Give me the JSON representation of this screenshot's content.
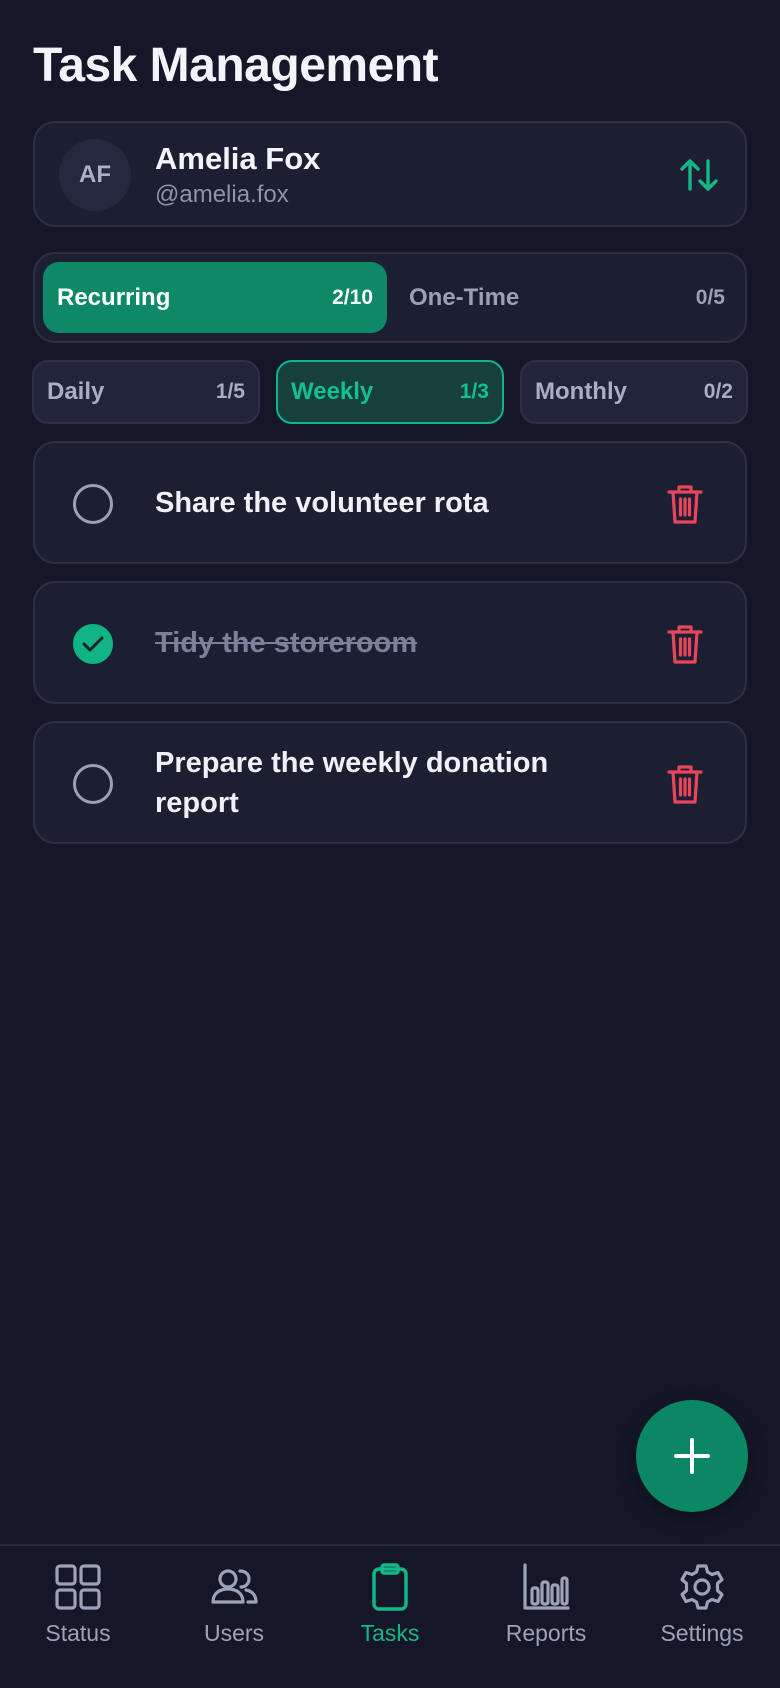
{
  "header": {
    "title": "Task Management"
  },
  "user": {
    "initials": "AF",
    "name": "Amelia Fox",
    "handle": "@amelia.fox"
  },
  "mode_tabs": [
    {
      "label": "Recurring",
      "count": "2/10",
      "active": true
    },
    {
      "label": "One-Time",
      "count": "0/5",
      "active": false
    }
  ],
  "period_tabs": [
    {
      "label": "Daily",
      "count": "1/5",
      "active": false
    },
    {
      "label": "Weekly",
      "count": "1/3",
      "active": true
    },
    {
      "label": "Monthly",
      "count": "0/2",
      "active": false
    }
  ],
  "tasks": [
    {
      "text": "Share the volunteer rota",
      "done": false
    },
    {
      "text": "Tidy the storeroom",
      "done": true
    },
    {
      "text": "Prepare the weekly donation report",
      "done": false
    }
  ],
  "nav": [
    {
      "label": "Status",
      "icon": "grid-icon",
      "active": false
    },
    {
      "label": "Users",
      "icon": "users-icon",
      "active": false
    },
    {
      "label": "Tasks",
      "icon": "clipboard-icon",
      "active": true
    },
    {
      "label": "Reports",
      "icon": "bar-chart-icon",
      "active": false
    },
    {
      "label": "Settings",
      "icon": "gear-icon",
      "active": false
    }
  ],
  "colors": {
    "background": "#151728",
    "card": "#1c1e32",
    "accent": "#10b583",
    "accent_dark": "#0d8a65",
    "danger": "#e8465b"
  }
}
